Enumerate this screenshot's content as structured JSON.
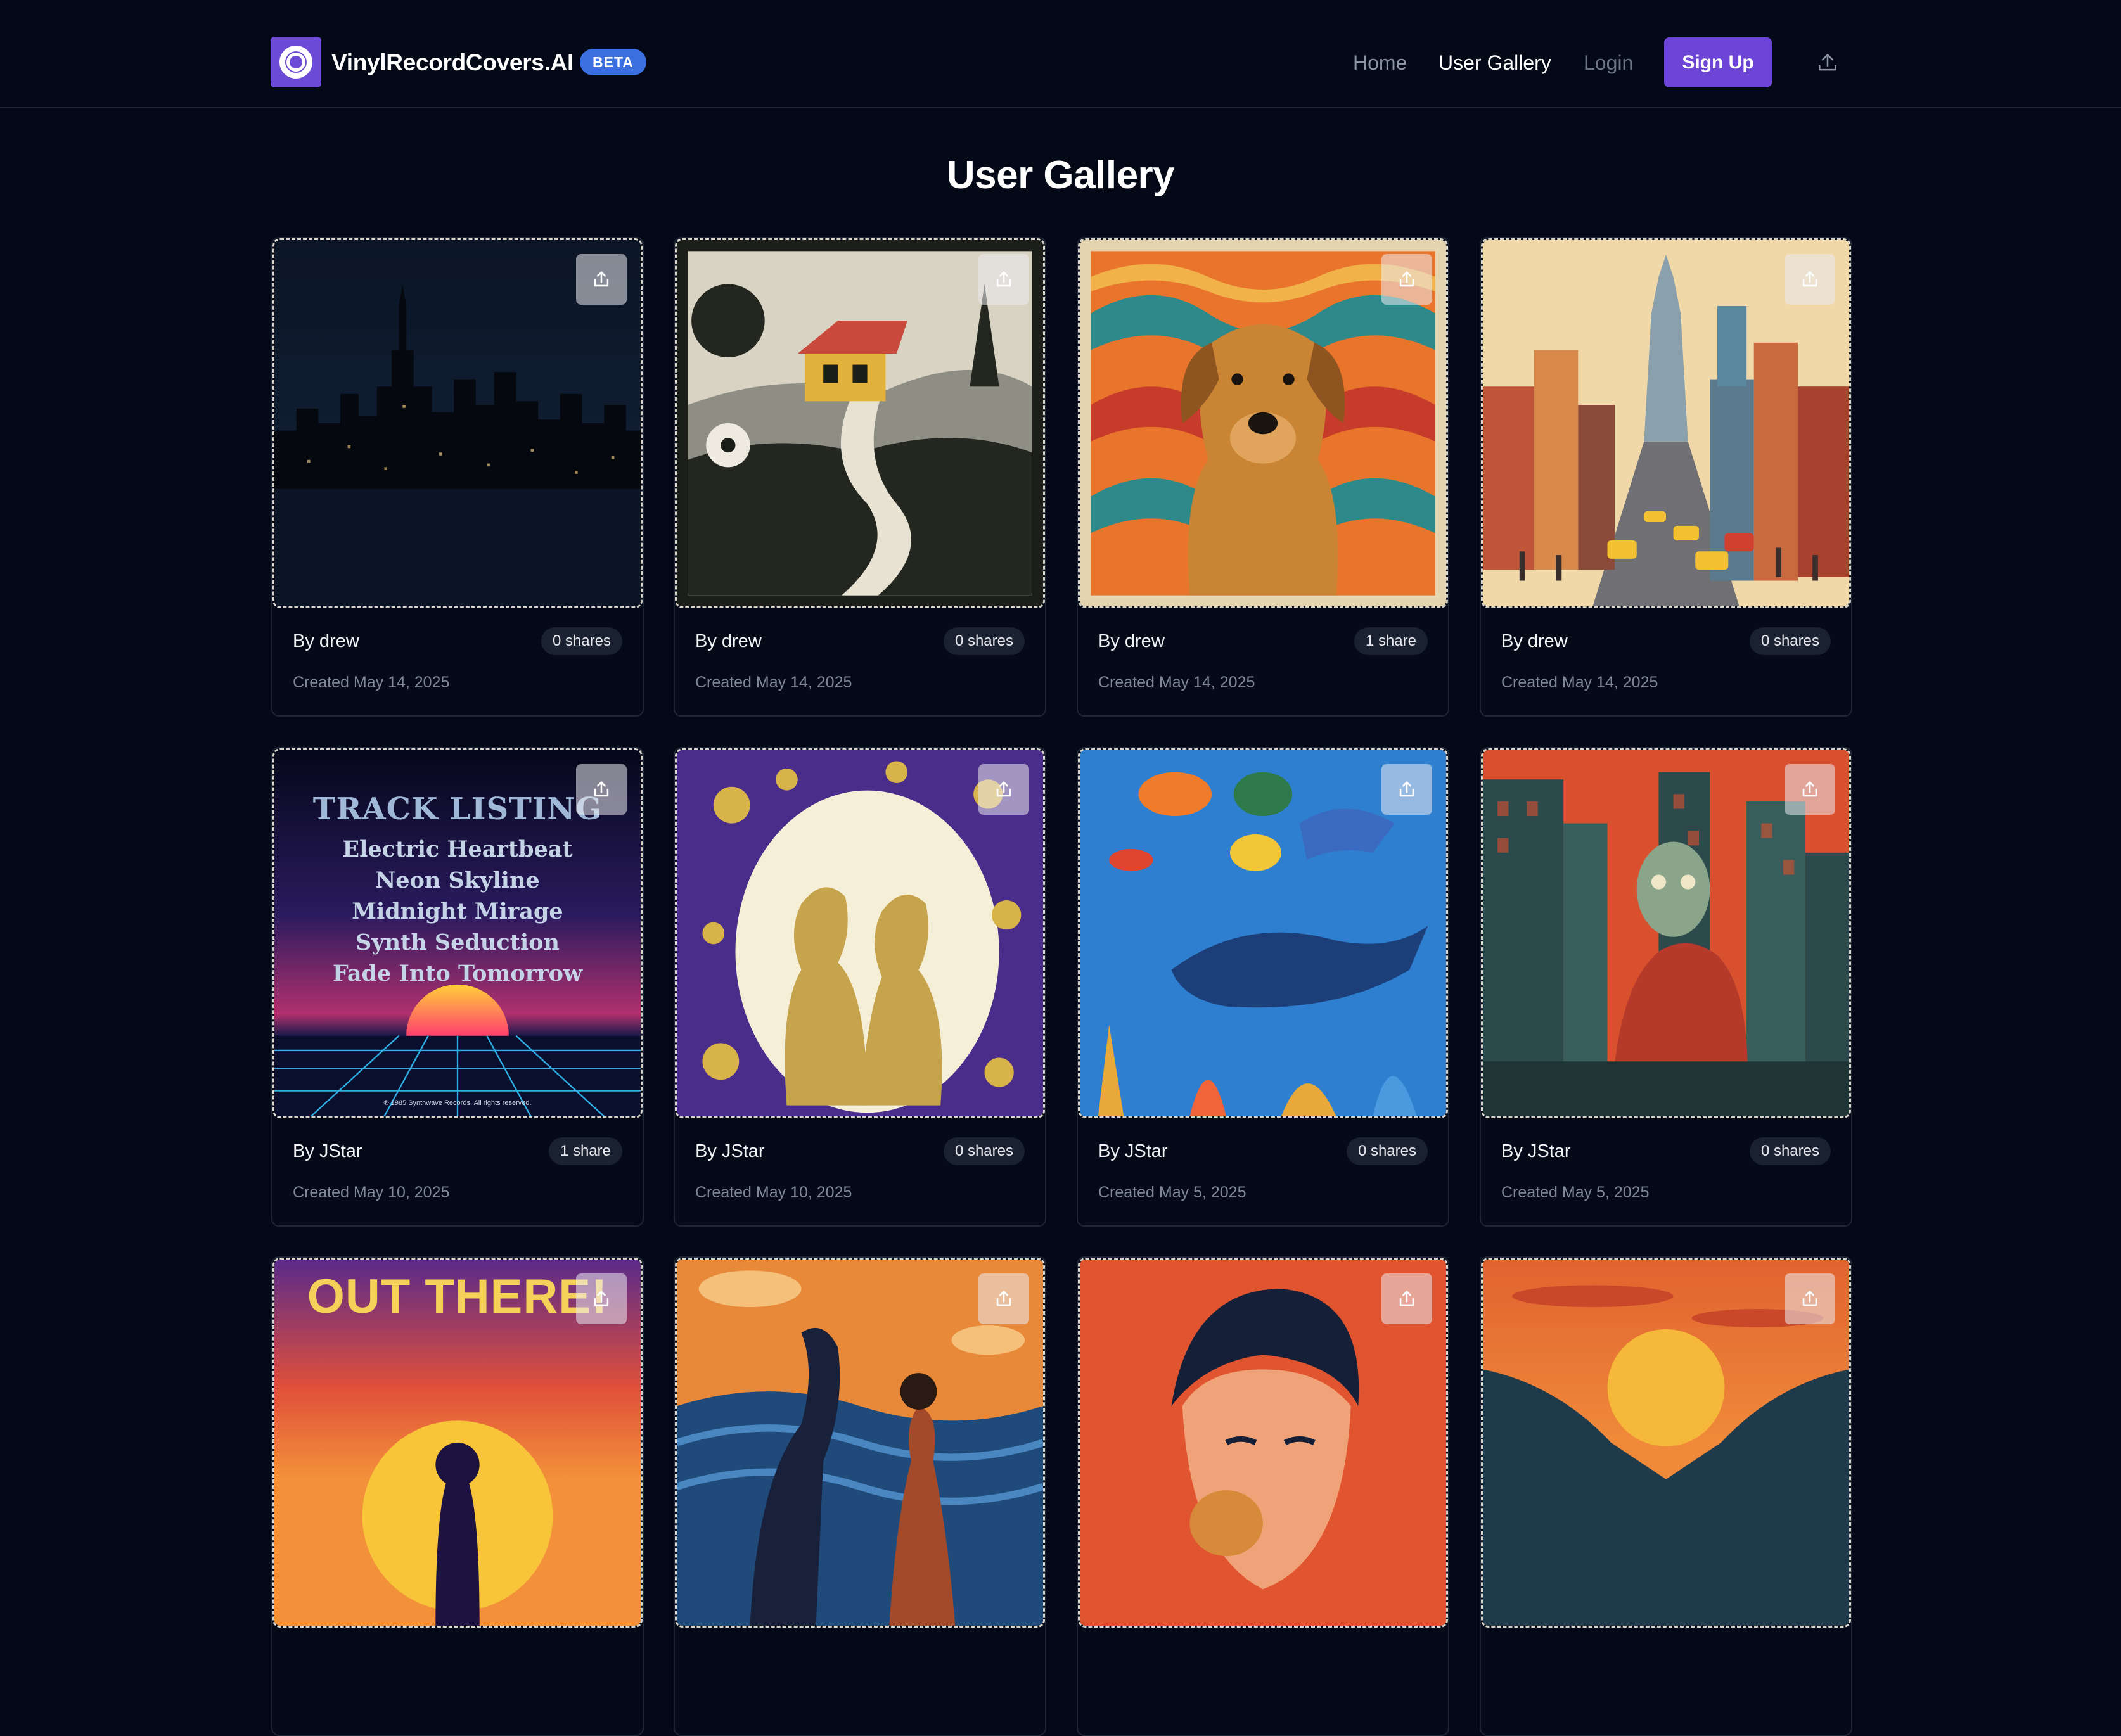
{
  "header": {
    "brand": "VinylRecordCovers.AI",
    "badge": "BETA",
    "nav": {
      "home": "Home",
      "gallery": "User Gallery",
      "login": "Login"
    },
    "signup": "Sign Up",
    "icons": {
      "logo": "vinyl-record-icon",
      "upload": "upload-icon"
    }
  },
  "page": {
    "title": "User Gallery"
  },
  "cards": [
    {
      "author": "By drew",
      "shares": "0 shares",
      "created": "Created May 14, 2025",
      "art": "night-city-skyline"
    },
    {
      "author": "By drew",
      "shares": "0 shares",
      "created": "Created May 14, 2025",
      "art": "woodcut-cottage"
    },
    {
      "author": "By drew",
      "shares": "1 share",
      "created": "Created May 14, 2025",
      "art": "dog-psychedelic"
    },
    {
      "author": "By drew",
      "shares": "0 shares",
      "created": "Created May 14, 2025",
      "art": "city-street-taxis"
    },
    {
      "author": "By JStar",
      "shares": "1 share",
      "created": "Created May 10, 2025",
      "art": "synthwave-tracklist",
      "text": {
        "heading": "TRACK LISTING",
        "tracks": [
          "Electric Heartbeat",
          "Neon Skyline",
          "Midnight Mirage",
          "Synth Seduction",
          "Fade Into Tomorrow"
        ],
        "footer": "℗ 1985 Synthwave Records. All rights reserved."
      }
    },
    {
      "author": "By JStar",
      "shares": "0 shares",
      "created": "Created May 10, 2025",
      "art": "wedding-floral"
    },
    {
      "author": "By JStar",
      "shares": "0 shares",
      "created": "Created May 5, 2025",
      "art": "ocean-life"
    },
    {
      "author": "By JStar",
      "shares": "0 shares",
      "created": "Created May 5, 2025",
      "art": "zombie-city"
    },
    {
      "author": "",
      "shares": "",
      "created": "",
      "art": "out-there-astronaut",
      "text": {
        "heading": "OUT THERE!"
      }
    },
    {
      "author": "",
      "shares": "",
      "created": "",
      "art": "dancing-couple"
    },
    {
      "author": "",
      "shares": "",
      "created": "",
      "art": "man-eating"
    },
    {
      "author": "",
      "shares": "",
      "created": "",
      "art": "sunset-mountains"
    }
  ],
  "colors": {
    "background": "#030916",
    "accent": "#6d45d6",
    "beta": "#3b6fe0"
  }
}
